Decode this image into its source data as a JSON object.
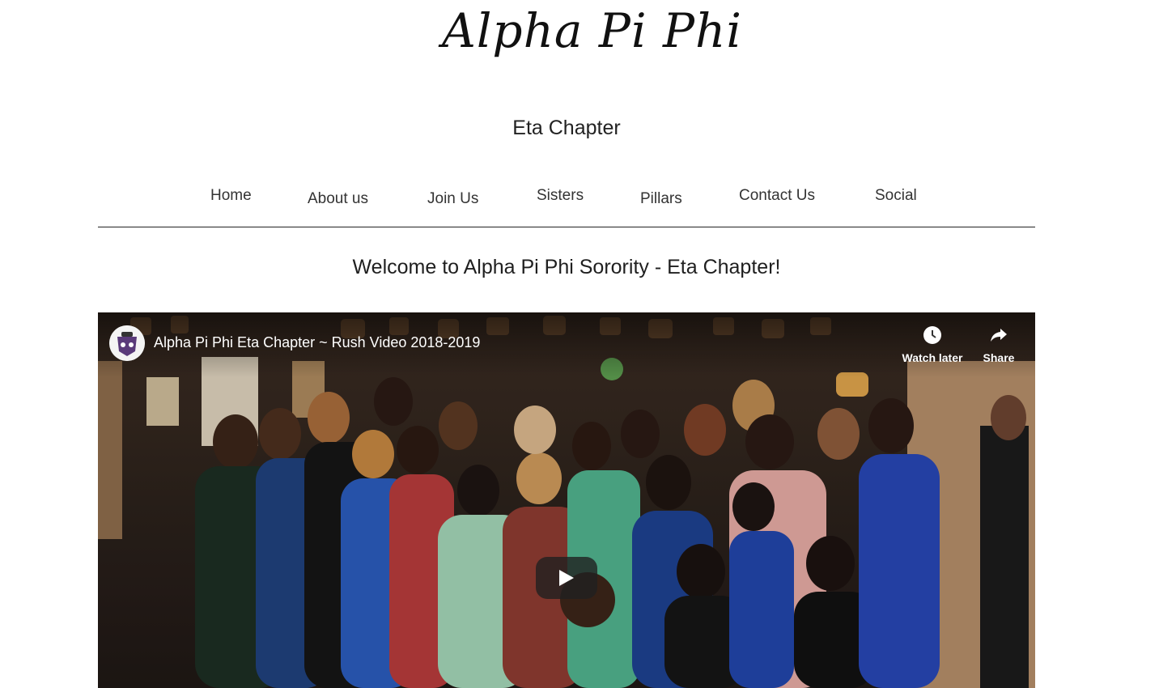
{
  "logo": {
    "text": "Alpha Pi Phi"
  },
  "chapter": "Eta Chapter",
  "nav": {
    "items": [
      "Home",
      "About us",
      "Join Us",
      "Sisters",
      "Pillars",
      "Contact Us",
      "Social"
    ]
  },
  "welcome": "Welcome to Alpha Pi Phi Sorority - Eta Chapter!",
  "video": {
    "title": "Alpha Pi Phi Eta Chapter ~ Rush Video 2018-2019",
    "watch_later": "Watch later",
    "share": "Share",
    "icons": {
      "watch_later": "clock-icon",
      "share": "share-arrow-icon",
      "play": "play-icon"
    }
  }
}
